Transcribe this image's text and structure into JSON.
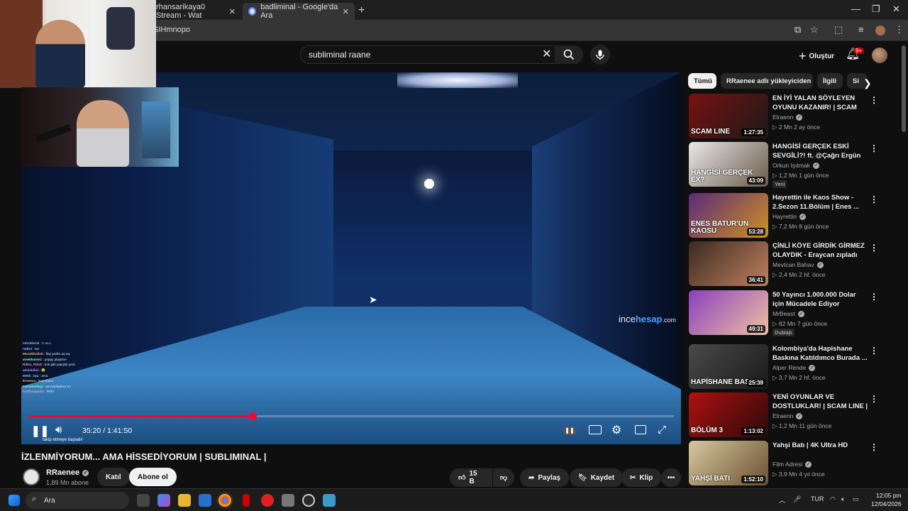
{
  "browser": {
    "tabs": [
      {
        "label": "rhansarikaya0 Stream - Wat"
      },
      {
        "label": "badliminal - Google'da Ara"
      }
    ],
    "url": "SIHmnopo"
  },
  "youtube": {
    "search_value": "subliminal raane",
    "create_label": "Oluştur",
    "notifications_badge": "9+",
    "player": {
      "time": "35:20 / 1:41:50",
      "progress_fraction": 0.347,
      "watermark_prefix": "ince",
      "watermark_bold": "hesap",
      "watermark_suffix": ".com",
      "follow_text": "takip etmeye başladı!",
      "chat": [
        {
          "user": "mitchIbrok",
          "msg": "C ve L"
        },
        {
          "user": "redbrt",
          "msg": "lan"
        },
        {
          "user": "Murathhalloti",
          "msg": "flaş yedim aq aq"
        },
        {
          "user": "vinekhanor1",
          "msg": "poppy playtime"
        },
        {
          "user": "Nikita_frdvtt",
          "msg": "bok gibi yapıştık yere"
        },
        {
          "user": "amininiksi",
          "msg": "😂"
        },
        {
          "user": "Mekh_2qu",
          "msg": "ama"
        },
        {
          "user": "Ersenca",
          "msg": "hapıshane"
        },
        {
          "user": "Ferhatverkçy",
          "msg": "aa hatırladınız mı"
        },
        {
          "user": "KarDurapow1",
          "msg": "PEKİ"
        }
      ]
    },
    "video": {
      "title": "İZLENMİYORUM... AMA HİSSEDİYORUM | SUBLIMINAL |",
      "channel": "RRaenee",
      "subscribers": "1,89 Mn abone",
      "join_label": "Katıl",
      "subscribe_label": "Abone ol",
      "likes": "15 B",
      "share_label": "Paylaş",
      "save_label": "Kaydet",
      "clip_label": "Klip"
    },
    "chips": [
      {
        "label": "Tümü",
        "selected": true
      },
      {
        "label": "RRaenee adlı yükleyiciden",
        "selected": false
      },
      {
        "label": "İlgili",
        "selected": false
      },
      {
        "label": "Si",
        "selected": false
      }
    ],
    "recommendations": [
      {
        "title": "EN İYİ YALAN SÖYLEYEN OYUNU KAZANIR! | SCAM LIN...",
        "channel": "Elraenn",
        "verified": true,
        "meta": "▷ 2 Mn   2 ay önce",
        "duration": "1:27:35",
        "thumb_text": "SCAM LINE",
        "badge": "",
        "thumb_color_a": "#7a1010",
        "thumb_color_b": "#1a1a1a"
      },
      {
        "title": "HANGİSİ GERÇEK ESKİ SEVGİLİ?! ft. @Çağrı Ergün",
        "channel": "Orkun Işıtmak",
        "verified": true,
        "meta": "▷ 1,2 Mn   1 gün önce",
        "duration": "43:09",
        "thumb_text": "HANGİSİ GERÇEK EX?",
        "badge": "Yeni",
        "thumb_color_a": "#e9e9e9",
        "thumb_color_b": "#6a5a4a"
      },
      {
        "title": "Hayrettin ile Kaos Show - 2.Sezon 11.Bölüm | Enes ...",
        "channel": "Hayrettin",
        "verified": true,
        "meta": "▷ 7,2 Mn   8 gün önce",
        "duration": "53:28",
        "thumb_text": "ENES BATUR'UN KAOSU",
        "badge": "",
        "thumb_color_a": "#5a2a7a",
        "thumb_color_b": "#d09020"
      },
      {
        "title": "ÇİNLİ KÖYE GİRDİK GİRMEZ OLAYDIK - Eraycan zıpladı",
        "channel": "Mevtcan Bahav",
        "verified": true,
        "meta": "▷ 2,4 Mn   2 hf. önce",
        "duration": "36:41",
        "thumb_text": "",
        "badge": "",
        "thumb_color_a": "#3a2a20",
        "thumb_color_b": "#c08060"
      },
      {
        "title": "50 Yayıncı 1.000.000 Dolar için Mücadele Ediyor",
        "channel": "MrBeast",
        "verified": true,
        "meta": "▷ 82 Mn   7 gün önce",
        "duration": "49:31",
        "thumb_text": "",
        "badge": "Dublajlı",
        "thumb_color_a": "#8a40c0",
        "thumb_color_b": "#f0c0a0"
      },
      {
        "title": "Kolombiya'da Hapishane Baskına Katıldımco Burada ...",
        "channel": "Alper Rende",
        "verified": true,
        "meta": "▷ 3,7 Mn   2 hf. önce",
        "duration": "25:39",
        "thumb_text": "HAPİSHANE BASKINI",
        "badge": "",
        "thumb_color_a": "#4a4a4a",
        "thumb_color_b": "#1a1a1a"
      },
      {
        "title": "YENİ OYUNLAR VE DOSTLUKLAR! | SCAM LINE | ...",
        "channel": "Elraenn",
        "verified": true,
        "meta": "▷ 1,2 Mn   11 gün önce",
        "duration": "1:13:02",
        "thumb_text": "BÖLÜM 3",
        "badge": "",
        "thumb_color_a": "#b01010",
        "thumb_color_b": "#2a0a0a"
      },
      {
        "title": "Yahşi Batı | 4K Ultra HD",
        "channel": "Film Adresi",
        "verified": true,
        "meta": "▷ 3,9 Mn   4 yıl önce",
        "duration": "1:52:10",
        "thumb_text": "YAHŞİ BATI",
        "badge": "",
        "thumb_color_a": "#d8c8a0",
        "thumb_color_b": "#6a5030"
      }
    ]
  },
  "taskbar": {
    "search_placeholder": "Ara",
    "lang": "TUR",
    "time": "12:05 pm",
    "date": "12/04/2026"
  }
}
